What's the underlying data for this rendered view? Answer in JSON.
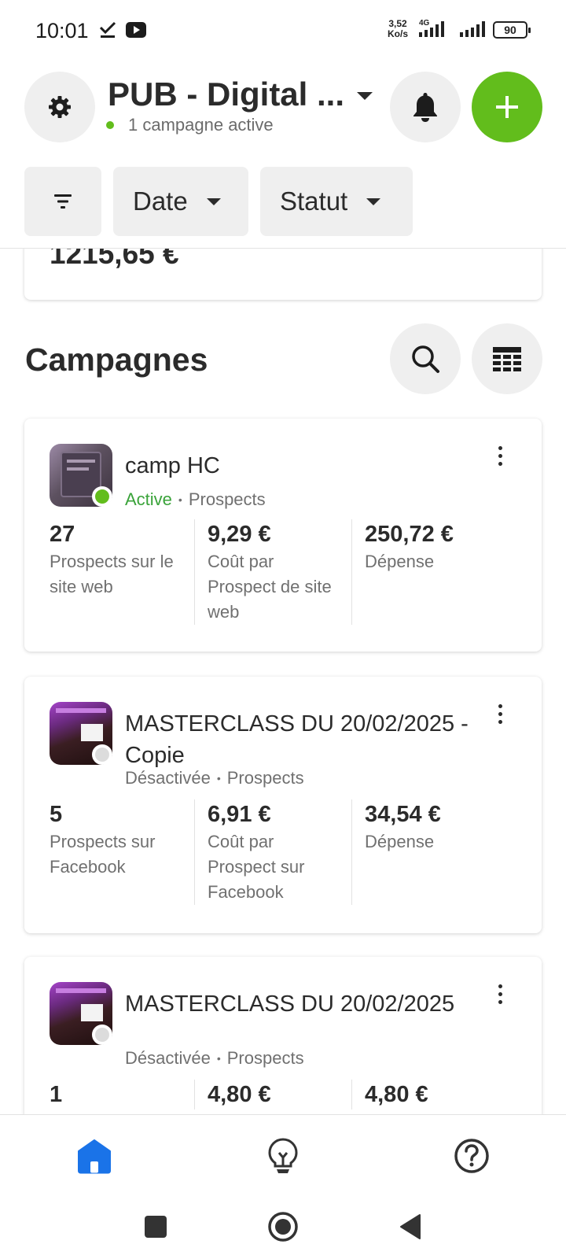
{
  "status_bar": {
    "time": "10:01",
    "net_speed_value": "3,52",
    "net_speed_unit": "Ko/s",
    "network_type": "4G",
    "battery": "90"
  },
  "header": {
    "account_title": "PUB - Digital ...",
    "active_count": "1 campagne active",
    "icons": {
      "settings": "gear-icon",
      "notifications": "bell-icon",
      "create": "plus-icon"
    }
  },
  "filters": {
    "date_label": "Date",
    "status_label": "Statut"
  },
  "summary": {
    "amount": "1215,65 €"
  },
  "campaigns_section": {
    "title": "Campagnes"
  },
  "campaigns": [
    {
      "name": "camp HC",
      "status": "Active",
      "objective": "Prospects",
      "metrics": [
        {
          "value": "27",
          "label": "Prospects sur le site web"
        },
        {
          "value": "9,29 €",
          "label": "Coût par Prospect de site web"
        },
        {
          "value": "250,72 €",
          "label": "Dépense"
        }
      ]
    },
    {
      "name": "MASTERCLASS DU 20/02/2025 - Copie",
      "status": "Désactivée",
      "objective": "Prospects",
      "metrics": [
        {
          "value": "5",
          "label": "Prospects sur Facebook"
        },
        {
          "value": "6,91 €",
          "label": "Coût par Prospect sur Facebook"
        },
        {
          "value": "34,54 €",
          "label": "Dépense"
        }
      ]
    },
    {
      "name": "MASTERCLASS DU 20/02/2025",
      "status": "Désactivée",
      "objective": "Prospects",
      "metrics": [
        {
          "value": "1",
          "label": ""
        },
        {
          "value": "4,80 €",
          "label": ""
        },
        {
          "value": "4,80 €",
          "label": ""
        }
      ]
    }
  ],
  "colors": {
    "accent_green": "#62bd1c",
    "active_text": "#3aa33a",
    "home_blue": "#1a73e8",
    "chip_bg": "#efefef",
    "inactive_dot": "#dcdcdc"
  }
}
